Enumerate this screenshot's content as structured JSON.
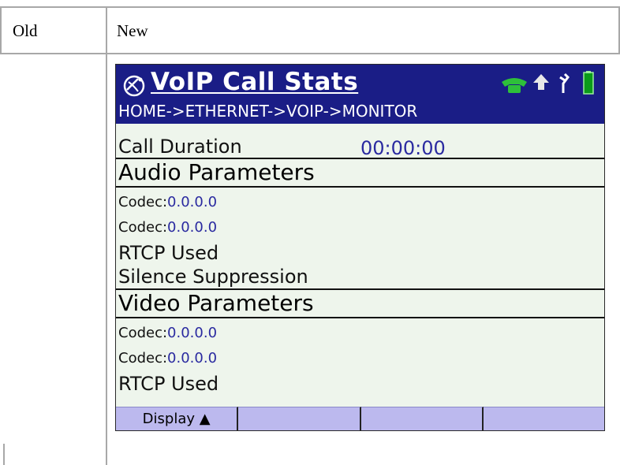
{
  "table": {
    "header_old": "Old",
    "header_new": "New"
  },
  "device": {
    "title": "VoIP Call Stats",
    "breadcrumb": "HOME->ETHERNET->VOIP->MONITOR",
    "call_duration": {
      "label": "Call Duration",
      "value": "00:00:00"
    },
    "audio": {
      "heading": "Audio Parameters",
      "codec_label": "Codec:",
      "codec1": "0.0.0.0",
      "codec2": "0.0.0.0",
      "rtcp": "RTCP Used",
      "silence": "Silence Suppression"
    },
    "video": {
      "heading": "Video Parameters",
      "codec_label": "Codec:",
      "codec1": "0.0.0.0",
      "codec2": "0.0.0.0",
      "rtcp": "RTCP Used"
    },
    "softkeys": [
      "Display ▲",
      "",
      "",
      ""
    ],
    "colors": {
      "titlebar": "#1a1d86",
      "value": "#2a2aa0",
      "softkey": "#bcb9ee",
      "screen": "#eef5ec"
    },
    "icons": [
      "satellite-dish-icon",
      "phone-icon",
      "upload-arrow-icon",
      "power-plug-icon",
      "battery-icon"
    ]
  }
}
